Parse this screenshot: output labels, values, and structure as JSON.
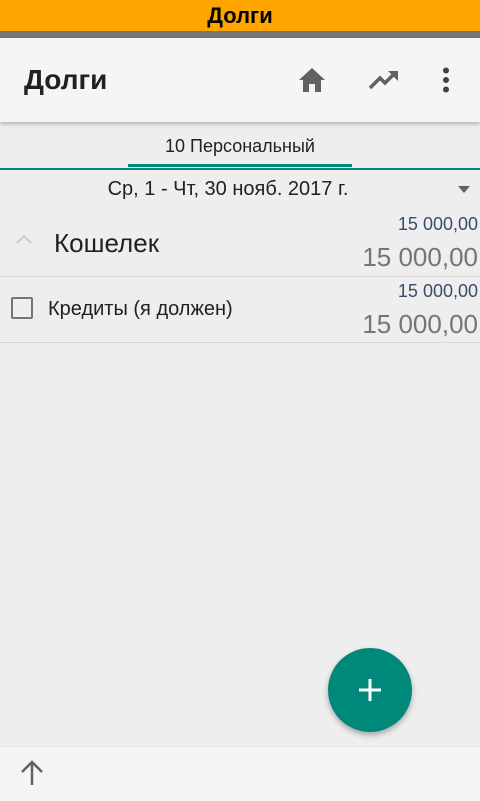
{
  "status_title": "Долги",
  "app_bar": {
    "title": "Долги",
    "icons": [
      "home-icon",
      "trending-up-icon",
      "more-vert-icon"
    ]
  },
  "tabs": [
    {
      "label": "10 Персональный",
      "selected": true
    }
  ],
  "date_range": "Ср, 1 - Чт, 30 нояб. 2017 г.",
  "group": {
    "name": "Кошелек",
    "amount_top": "15 000,00",
    "amount_bottom": "15 000,00"
  },
  "items": [
    {
      "name": "Кредиты (я должен)",
      "amount_top": "15 000,00",
      "amount_bottom": "15 000,00",
      "checked": false
    }
  ],
  "colors": {
    "status_bar": "#ffa500",
    "accent": "#00897b",
    "amount_blue": "#3a4d66",
    "amount_gray": "#757575"
  }
}
